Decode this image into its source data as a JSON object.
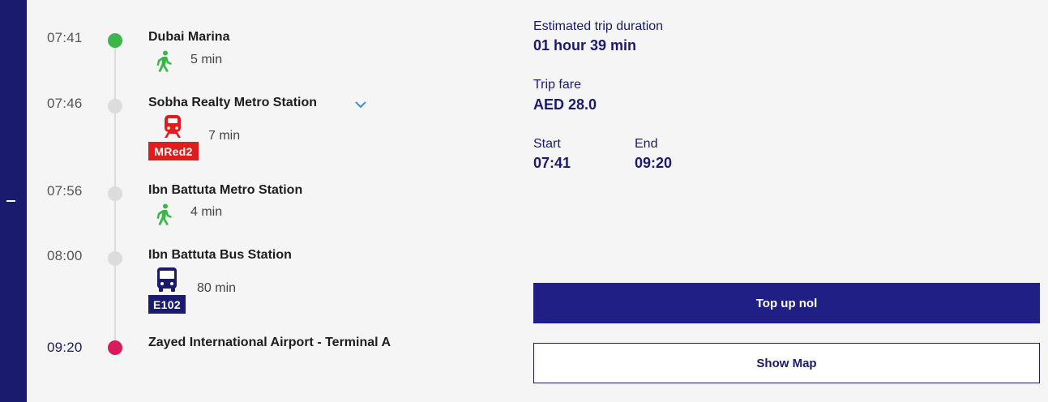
{
  "timeline": {
    "stops": [
      {
        "time": "07:41",
        "name": "Dubai Marina"
      },
      {
        "time": "07:46",
        "name": "Sobha Realty Metro Station"
      },
      {
        "time": "07:56",
        "name": "Ibn Battuta Metro Station"
      },
      {
        "time": "08:00",
        "name": "Ibn Battuta Bus Station"
      },
      {
        "time": "09:20",
        "name": "Zayed International Airport - Terminal A"
      }
    ],
    "legs": [
      {
        "mode": "walk",
        "icon": "walking-person-icon",
        "duration": "5 min"
      },
      {
        "mode": "metro",
        "icon": "metro-train-icon",
        "line": "MRed2",
        "duration": "7 min"
      },
      {
        "mode": "walk",
        "icon": "walking-person-icon",
        "duration": "4 min"
      },
      {
        "mode": "bus",
        "icon": "bus-icon",
        "line": "E102",
        "duration": "80 min"
      }
    ]
  },
  "summary": {
    "duration_label": "Estimated trip duration",
    "duration_value": "01 hour 39 min",
    "fare_label": "Trip fare",
    "fare_value": "AED 28.0",
    "start_label": "Start",
    "start_value": "07:41",
    "end_label": "End",
    "end_value": "09:20"
  },
  "actions": {
    "top_up_label": "Top up nol",
    "show_map_label": "Show Map"
  },
  "colors": {
    "navy": "#1a1a6e",
    "start_dot": "#3cb54a",
    "end_dot": "#d81b5a",
    "walk_green": "#3cb54a",
    "metro_red": "#e11c1c",
    "background": "#f5f5f5"
  }
}
